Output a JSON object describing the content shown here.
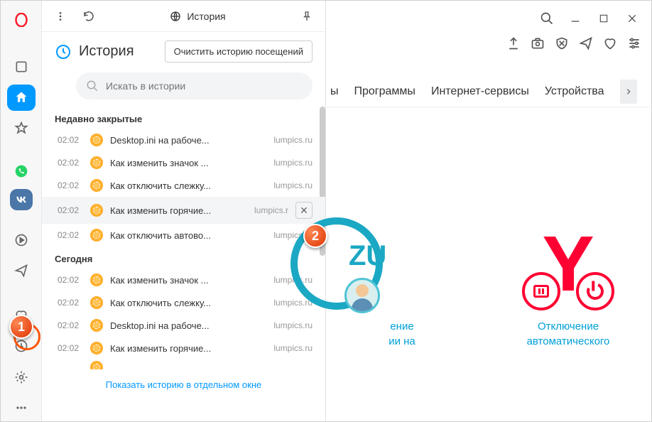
{
  "sidebar": {
    "logo": "opera"
  },
  "panel": {
    "tab_title": "История",
    "header_title": "История",
    "clear_btn": "Очистить историю посещений",
    "search_placeholder": "Искать в истории",
    "show_link": "Показать историю в отдельном окне"
  },
  "sections": [
    {
      "title": "Недавно закрытые",
      "items": [
        {
          "time": "02:02",
          "title": "Desktop.ini на рабоче...",
          "domain": "lumpics.ru"
        },
        {
          "time": "02:02",
          "title": "Как изменить значок ...",
          "domain": "lumpics.ru"
        },
        {
          "time": "02:02",
          "title": "Как отключить слежку...",
          "domain": "lumpics.ru"
        },
        {
          "time": "02:02",
          "title": "Как изменить горячие...",
          "domain": "lumpics.r",
          "hovered": true
        },
        {
          "time": "02:02",
          "title": "Как отключить автово...",
          "domain": "lumpics.ru"
        }
      ]
    },
    {
      "title": "Сегодня",
      "items": [
        {
          "time": "02:02",
          "title": "Как изменить значок ...",
          "domain": "lumpics.ru"
        },
        {
          "time": "02:02",
          "title": "Как отключить слежку...",
          "domain": "lumpics.ru"
        },
        {
          "time": "02:02",
          "title": "Desktop.ini на рабоче...",
          "domain": "lumpics.ru"
        },
        {
          "time": "02:02",
          "title": "Как изменить горячие...",
          "domain": "lumpics.ru"
        }
      ]
    }
  ],
  "nav": {
    "tab1": "ы",
    "tab2": "Программы",
    "tab3": "Интернет-сервисы",
    "tab4": "Устройства"
  },
  "cards": {
    "c1_l1": "ение",
    "c1_l2": "ии на",
    "c2_l1": "Отключение",
    "c2_l2": "автоматического",
    "zu": "ZU"
  },
  "badges": {
    "b1": "1",
    "b2": "2"
  }
}
